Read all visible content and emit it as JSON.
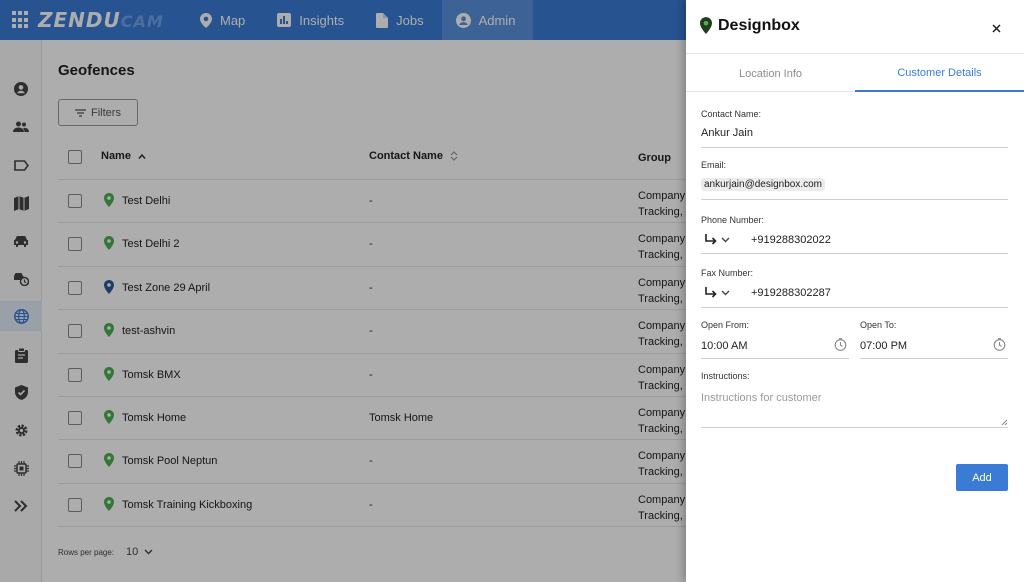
{
  "app": {
    "brand_main": "ZENDU",
    "brand_sub": "CAM"
  },
  "nav": {
    "tabs": [
      {
        "label": "Map",
        "icon": "map-pin-icon"
      },
      {
        "label": "Insights",
        "icon": "bar-chart-icon"
      },
      {
        "label": "Jobs",
        "icon": "document-icon"
      },
      {
        "label": "Admin",
        "icon": "user-circle-icon",
        "active": true
      }
    ]
  },
  "sidebar": {
    "items": [
      {
        "icon": "user-icon"
      },
      {
        "icon": "users-group-icon"
      },
      {
        "icon": "tag-icon"
      },
      {
        "icon": "map-icon"
      },
      {
        "icon": "car-icon"
      },
      {
        "icon": "car-history-icon"
      },
      {
        "icon": "globe-icon",
        "active": true
      },
      {
        "icon": "clipboard-icon"
      },
      {
        "icon": "shield-check-icon"
      },
      {
        "icon": "gear-icon"
      },
      {
        "icon": "chip-icon"
      },
      {
        "icon": "chevrons-right-icon"
      }
    ]
  },
  "page": {
    "title": "Geofences",
    "filters_label": "Filters"
  },
  "table": {
    "columns": {
      "name": "Name",
      "contact": "Contact Name",
      "group": "Group"
    },
    "rows": [
      {
        "name": "Test Delhi",
        "contact": "-",
        "group1": "Company",
        "group2": "Tracking,",
        "pin": "#4caf50"
      },
      {
        "name": "Test Delhi 2",
        "contact": "-",
        "group1": "Company",
        "group2": "Tracking,",
        "pin": "#4caf50"
      },
      {
        "name": "Test Zone 29 April",
        "contact": "-",
        "group1": "Company",
        "group2": "Tracking,",
        "pin": "#2c5a9c"
      },
      {
        "name": "test-ashvin",
        "contact": "-",
        "group1": "Company",
        "group2": "Tracking,",
        "pin": "#4caf50"
      },
      {
        "name": "Tomsk BMX",
        "contact": "-",
        "group1": "Company",
        "group2": "Tracking,",
        "pin": "#4caf50"
      },
      {
        "name": "Tomsk Home",
        "contact": "Tomsk Home",
        "group1": "Company",
        "group2": "Tracking,",
        "pin": "#4caf50"
      },
      {
        "name": "Tomsk Pool Neptun",
        "contact": "-",
        "group1": "Company",
        "group2": "Tracking,",
        "pin": "#4caf50"
      },
      {
        "name": "Tomsk Training Kickboxing",
        "contact": "-",
        "group1": "Company",
        "group2": "Tracking,",
        "pin": "#4caf50"
      }
    ]
  },
  "pagination": {
    "rows_per_page_label": "Rows per page:",
    "rows_per_page_value": "10"
  },
  "drawer": {
    "title": "Designbox",
    "tabs": [
      {
        "label": "Location Info",
        "active": false
      },
      {
        "label": "Customer Details",
        "active": true
      }
    ],
    "contact_label": "Contact Name:",
    "contact_value": "Ankur Jain",
    "email_label": "Email:",
    "email_value": "ankurjain@designbox.com",
    "phone_label": "Phone Number:",
    "phone_value": "+919288302022",
    "fax_label": "Fax Number:",
    "fax_value": "+919288302287",
    "open_from_label": "Open From:",
    "open_from_value": "10:00 AM",
    "open_to_label": "Open To:",
    "open_to_value": "07:00 PM",
    "instructions_label": "Instructions:",
    "instructions_placeholder": "Instructions for customer",
    "add_label": "Add"
  },
  "colors": {
    "primary": "#3a7bd5",
    "pin_green": "#4caf50",
    "pin_blue": "#2c5a9c"
  }
}
